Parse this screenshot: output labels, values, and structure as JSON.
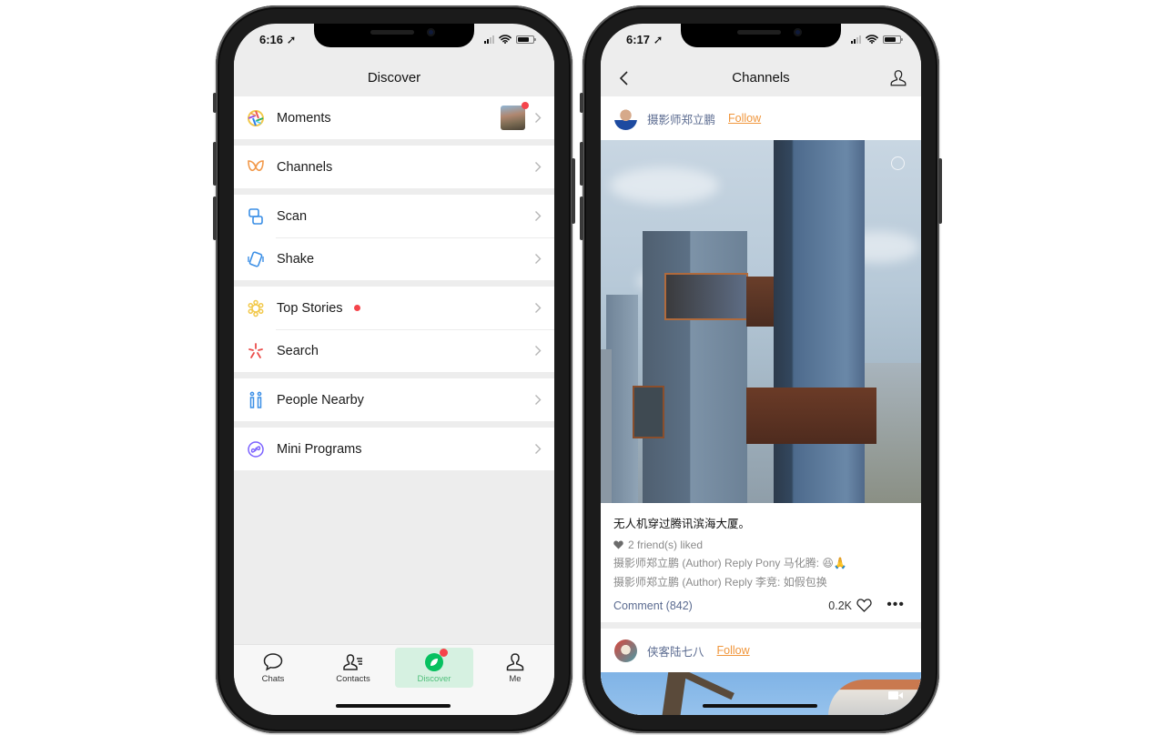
{
  "left_phone": {
    "status": {
      "time": "6:16"
    },
    "nav": {
      "title": "Discover"
    },
    "groups": [
      [
        {
          "label": "Moments",
          "icon": "moments-icon",
          "has_thumbnail": true,
          "thumbnail_badge": true
        }
      ],
      [
        {
          "label": "Channels",
          "icon": "channels-icon"
        }
      ],
      [
        {
          "label": "Scan",
          "icon": "scan-icon"
        },
        {
          "label": "Shake",
          "icon": "shake-icon"
        }
      ],
      [
        {
          "label": "Top Stories",
          "icon": "top-stories-icon",
          "red_dot": true
        },
        {
          "label": "Search",
          "icon": "search-icon"
        }
      ],
      [
        {
          "label": "People Nearby",
          "icon": "people-nearby-icon"
        }
      ],
      [
        {
          "label": "Mini Programs",
          "icon": "mini-programs-icon"
        }
      ]
    ],
    "tabs": [
      {
        "label": "Chats",
        "icon": "chat-bubble-icon",
        "active": false
      },
      {
        "label": "Contacts",
        "icon": "contacts-icon",
        "active": false
      },
      {
        "label": "Discover",
        "icon": "compass-icon",
        "active": true,
        "badge": true
      },
      {
        "label": "Me",
        "icon": "person-icon",
        "active": false
      }
    ],
    "colors": {
      "accent_green": "#07c160",
      "active_tab_bg": "#d6f1e1",
      "badge_red": "#f5444b"
    }
  },
  "right_phone": {
    "status": {
      "time": "6:17"
    },
    "nav": {
      "title": "Channels",
      "back_icon": "back-chevron-icon",
      "right_icon": "profile-icon"
    },
    "posts": [
      {
        "author": "摄影师郑立鹏",
        "follow_label": "Follow",
        "caption": "无人机穿过腾讯滨海大厦。",
        "friends_liked": "2 friend(s) liked",
        "comments": [
          "摄影师郑立鹏 (Author) Reply Pony 马化腾: 😆🙏",
          "摄影师郑立鹏 (Author) Reply 李竞: 如假包换"
        ],
        "comment_label": "Comment (842)",
        "like_count": "0.2K"
      },
      {
        "author": "侠客陆七八",
        "follow_label": "Follow"
      }
    ],
    "colors": {
      "follow_orange": "#f0963c",
      "author_blue": "#5b6b90"
    }
  }
}
